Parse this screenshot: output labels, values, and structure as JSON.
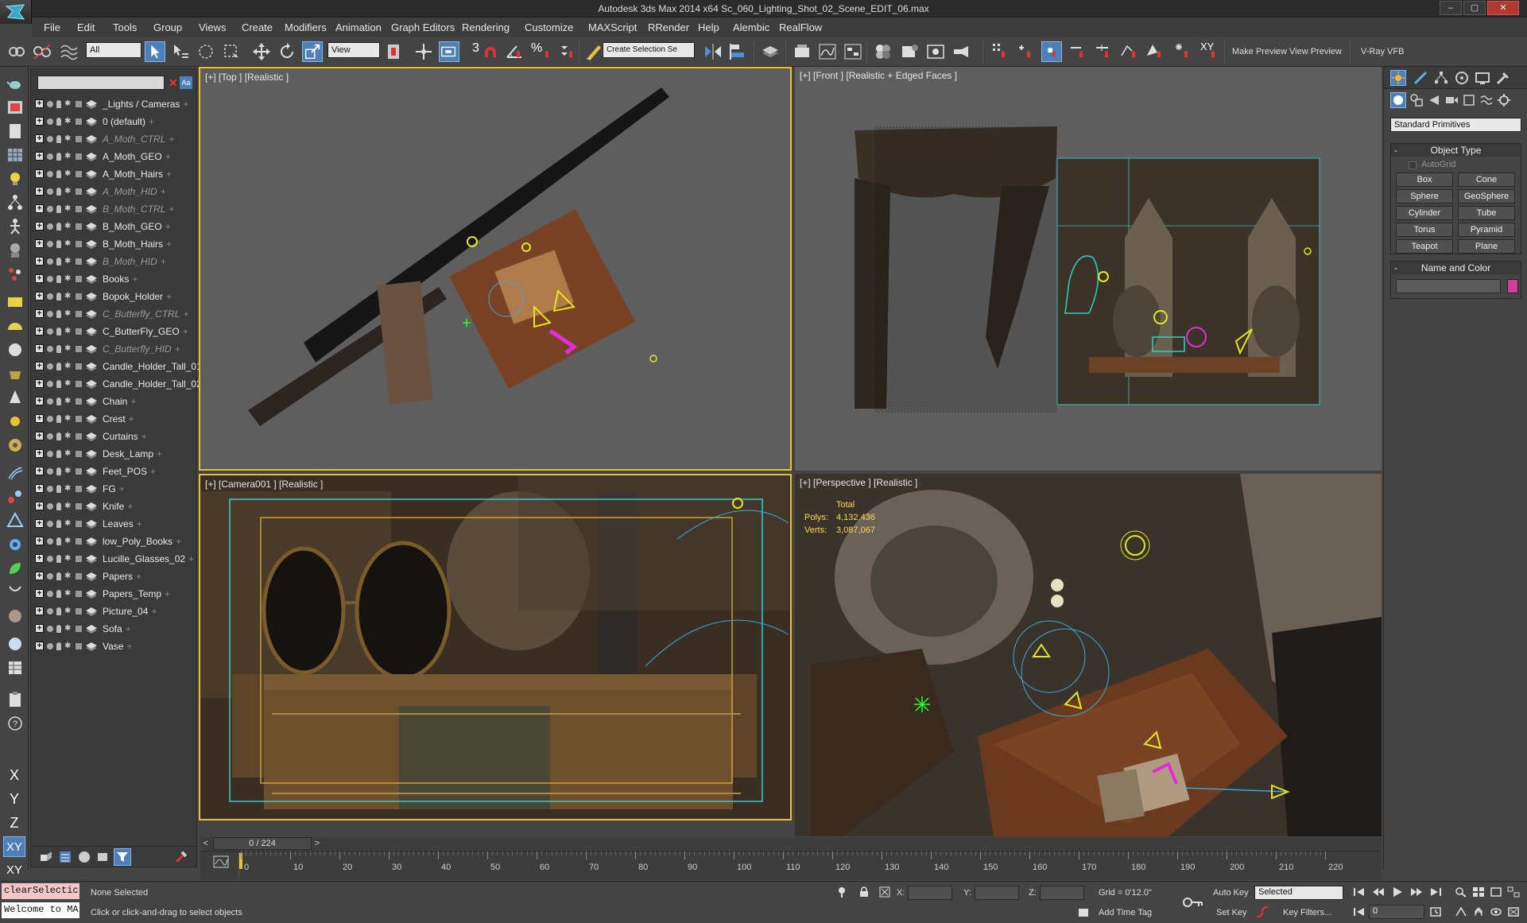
{
  "window": {
    "title": "Autodesk 3ds Max  2014 x64      Sc_060_Lighting_Shot_02_Scene_EDIT_06.max",
    "controls": [
      "–",
      "▢",
      "✕"
    ]
  },
  "menubar": {
    "items": [
      "File",
      "Edit",
      "Tools",
      "Group",
      "Views",
      "Create",
      "Modifiers",
      "Animation",
      "Graph Editors",
      "Rendering",
      "Customize",
      "MAXScript",
      "RRender",
      "Help",
      "Alembic",
      "RealFlow"
    ]
  },
  "toolbar": {
    "selection_filter": "All",
    "ref_coord": "View",
    "named_selection": "Create Selection Se",
    "snap_label": "3",
    "angle_label": "∠",
    "percent_label": "%",
    "xy_label": "XY",
    "make_preview": "Make Preview",
    "view_preview": "View Preview",
    "vray_vfb": "V-Ray VFB"
  },
  "explorer": {
    "search_value": "",
    "clear_icon": "✕",
    "case_toggle": "Aa",
    "layers": [
      {
        "name": "_Lights / Cameras",
        "hidden": false
      },
      {
        "name": "0 (default)",
        "hidden": false
      },
      {
        "name": "A_Moth_CTRL",
        "hidden": true
      },
      {
        "name": "A_Moth_GEO",
        "hidden": false
      },
      {
        "name": "A_Moth_Hairs",
        "hidden": false
      },
      {
        "name": "A_Moth_HID",
        "hidden": true
      },
      {
        "name": "B_Moth_CTRL",
        "hidden": true
      },
      {
        "name": "B_Moth_GEO",
        "hidden": false
      },
      {
        "name": "B_Moth_Hairs",
        "hidden": false
      },
      {
        "name": "B_Moth_HID",
        "hidden": true
      },
      {
        "name": "Books",
        "hidden": false
      },
      {
        "name": "Bopok_Holder",
        "hidden": false
      },
      {
        "name": "C_Butterfly_CTRL",
        "hidden": true
      },
      {
        "name": "C_ButterFly_GEO",
        "hidden": false
      },
      {
        "name": "C_Butterfly_HID",
        "hidden": true
      },
      {
        "name": "Candle_Holder_Tall_01",
        "hidden": false
      },
      {
        "name": "Candle_Holder_Tall_02",
        "hidden": false
      },
      {
        "name": "Chain",
        "hidden": false
      },
      {
        "name": "Crest",
        "hidden": false
      },
      {
        "name": "Curtains",
        "hidden": false
      },
      {
        "name": "Desk_Lamp",
        "hidden": false
      },
      {
        "name": "Feet_POS",
        "hidden": false
      },
      {
        "name": "FG",
        "hidden": false
      },
      {
        "name": "Knife",
        "hidden": false
      },
      {
        "name": "Leaves",
        "hidden": false
      },
      {
        "name": "low_Poly_Books",
        "hidden": false
      },
      {
        "name": "Lucille_Glasses_02",
        "hidden": false
      },
      {
        "name": "Papers",
        "hidden": false
      },
      {
        "name": "Papers_Temp",
        "hidden": false
      },
      {
        "name": "Picture_04",
        "hidden": false
      },
      {
        "name": "Sofa",
        "hidden": false
      },
      {
        "name": "Vase",
        "hidden": false
      }
    ]
  },
  "viewports": {
    "top": "[+] [Top ] [Realistic ]",
    "front": "[+] [Front ] [Realistic + Edged Faces ]",
    "camera": "[+] [Camera001 ] [Realistic ]",
    "perspective": "[+] [Perspective ] [Realistic ]",
    "stats": {
      "total_label": "Total",
      "polys_label": "Polys:",
      "polys_value": "4,132,436",
      "verts_label": "Verts:",
      "verts_value": "3,087,067"
    }
  },
  "command_panel": {
    "dropdown": "Standard Primitives",
    "object_type_title": "Object Type",
    "autogrid": "AutoGrid",
    "primitives": [
      "Box",
      "Cone",
      "Sphere",
      "GeoSphere",
      "Cylinder",
      "Tube",
      "Torus",
      "Pyramid",
      "Teapot",
      "Plane"
    ],
    "name_color_title": "Name and Color",
    "name_value": "",
    "color": "#d63a9c"
  },
  "timeline": {
    "frame_display": "0 / 224",
    "ticks": [
      "0",
      "10",
      "20",
      "30",
      "40",
      "50",
      "60",
      "70",
      "80",
      "90",
      "100",
      "110",
      "120",
      "130",
      "140",
      "150",
      "160",
      "170",
      "180",
      "190",
      "200",
      "210",
      "220"
    ]
  },
  "statusbar": {
    "maxscript_top": "clearSelectic",
    "maxscript_bottom": "Welcome to MA",
    "selection_status": "None Selected",
    "prompt": "Click or click-and-drag to select objects",
    "x_label": "X:",
    "y_label": "Y:",
    "z_label": "Z:",
    "grid": "Grid = 0'12.0\"",
    "add_time_tag": "Add Time Tag",
    "auto_key": "Auto Key",
    "set_key": "Set Key",
    "key_mode": "Selected",
    "key_filters": "Key Filters...",
    "current_frame": "0"
  }
}
